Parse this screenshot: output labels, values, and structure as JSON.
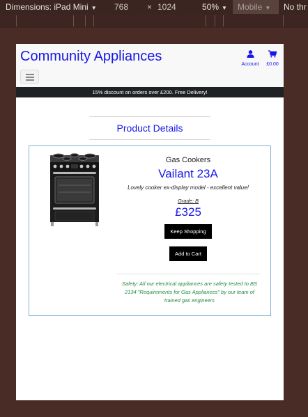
{
  "devtools": {
    "dimensions_label": "Dimensions: iPad Mini",
    "width": "768",
    "times": "×",
    "height": "1024",
    "zoom": "50%",
    "mode": "Mobile",
    "throttle": "No thr"
  },
  "header": {
    "brand": "Community Appliances",
    "account_label": "Account",
    "cart_total": "£0.00"
  },
  "banner": {
    "text": "15% discount on orders over £200. Free Delivery!"
  },
  "section": {
    "title": "Product Details"
  },
  "product": {
    "category": "Gas Cookers",
    "name": "Vailant 23A",
    "description": "Lovely cooker ex-display model - excellent value!",
    "grade": "Grade: B",
    "price": "£325",
    "keep_shopping_label": "Keep Shopping",
    "add_to_cart_label": "Add to Cart",
    "safety_note": "Safety: All our electrical appliances are safety tested to BS 2134 \"Requirements for Gas Appliances\" by our team of trained gas engineers"
  },
  "icons": {
    "account": "user-icon",
    "cart": "shopping-cart-icon",
    "menu": "hamburger-menu-icon"
  },
  "colors": {
    "brand": "#1717e8",
    "banner_bg": "#1f2125",
    "safety_text": "#1e8a3c",
    "card_border": "#7fb2d4"
  }
}
